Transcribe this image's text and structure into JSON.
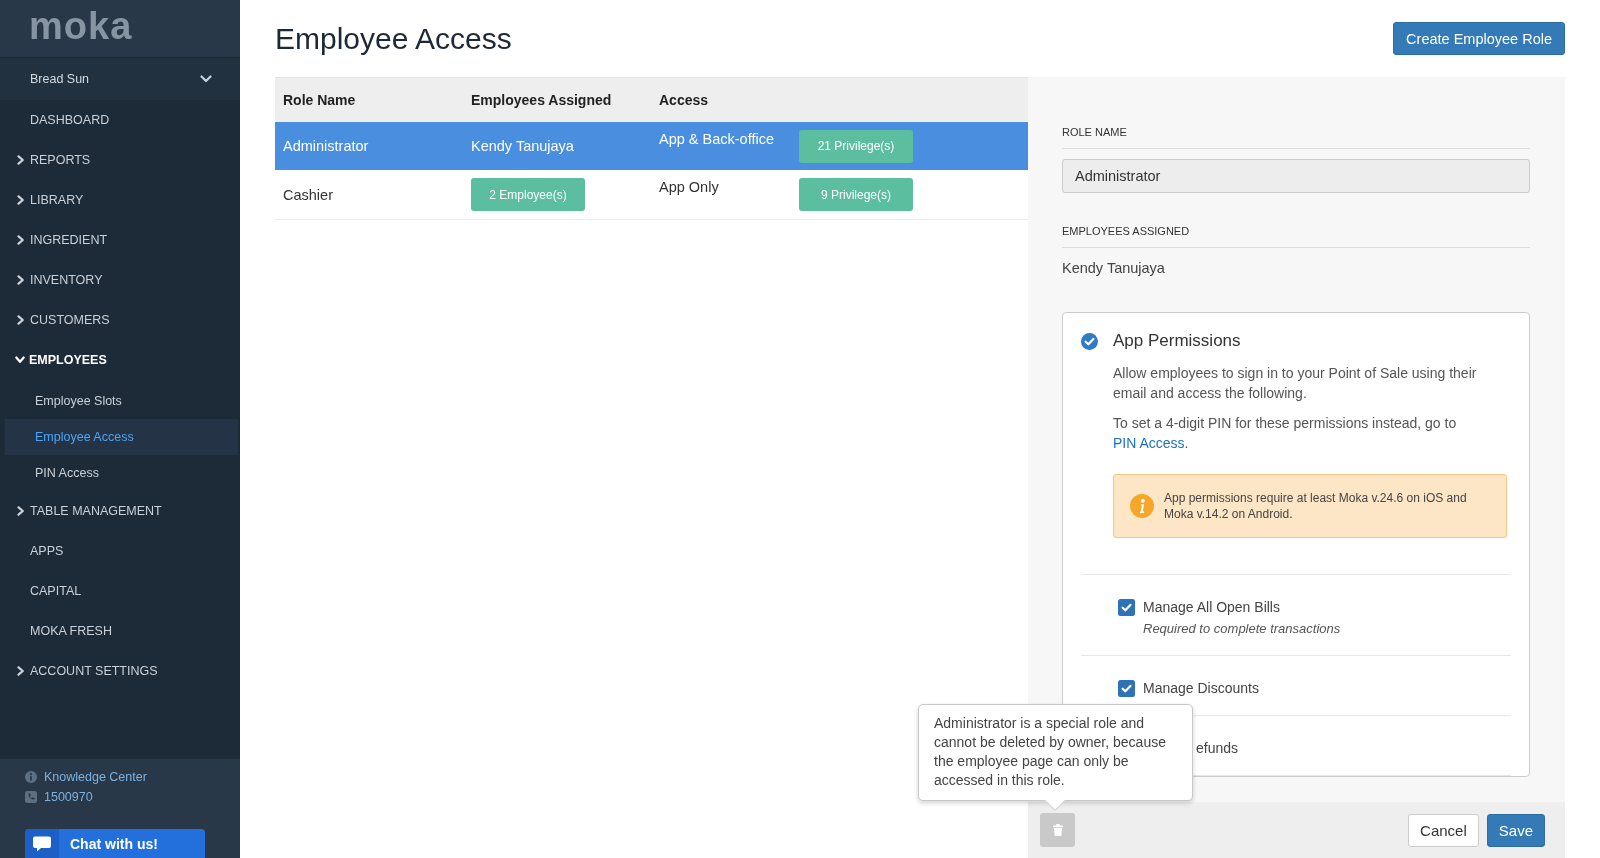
{
  "sidebar": {
    "logo": "moka",
    "store": "Bread Sun",
    "items": [
      {
        "label": "DASHBOARD",
        "kind": "link"
      },
      {
        "label": "REPORTS",
        "kind": "group",
        "expanded": false
      },
      {
        "label": "LIBRARY",
        "kind": "group",
        "expanded": false
      },
      {
        "label": "INGREDIENT",
        "kind": "group",
        "expanded": false
      },
      {
        "label": "INVENTORY",
        "kind": "group",
        "expanded": false
      },
      {
        "label": "CUSTOMERS",
        "kind": "group",
        "expanded": false
      },
      {
        "label": "EMPLOYEES",
        "kind": "group",
        "expanded": true,
        "children": [
          {
            "label": "Employee Slots",
            "selected": false
          },
          {
            "label": "Employee Access",
            "selected": true
          },
          {
            "label": "PIN Access",
            "selected": false
          }
        ]
      },
      {
        "label": "TABLE MANAGEMENT",
        "kind": "group",
        "expanded": false
      },
      {
        "label": "APPS",
        "kind": "link"
      },
      {
        "label": "CAPITAL",
        "kind": "link"
      },
      {
        "label": "MOKA FRESH",
        "kind": "link"
      },
      {
        "label": "ACCOUNT SETTINGS",
        "kind": "group",
        "expanded": false
      }
    ],
    "footer_links": [
      {
        "label": "Knowledge Center",
        "kind": "info"
      },
      {
        "label": "1500970",
        "kind": "phone"
      }
    ],
    "chat_button": "Chat with us!"
  },
  "header": {
    "title": "Employee Access",
    "create_button": "Create Employee Role"
  },
  "table": {
    "columns": [
      "Role Name",
      "Employees Assigned",
      "Access"
    ],
    "rows": [
      {
        "selected": true,
        "role": "Administrator",
        "employees": {
          "kind": "text",
          "text": "Kendy Tanujaya"
        },
        "access": "App & Back-office",
        "privileges": "21 Privilege(s)"
      },
      {
        "selected": false,
        "role": "Cashier",
        "employees": {
          "kind": "badge",
          "text": "2 Employee(s)"
        },
        "access": "App Only",
        "privileges": "9 Privilege(s)"
      }
    ]
  },
  "detail": {
    "role_name": {
      "label": "ROLE NAME",
      "value": "Administrator",
      "disabled": true
    },
    "employees_assigned": {
      "label": "EMPLOYEES ASSIGNED",
      "value": "Kendy Tanujaya"
    },
    "app_permissions": {
      "checked": true,
      "title": "App Permissions",
      "description": "Allow employees to sign in to your Point of Sale using their email and access the following.",
      "pin_note": "To set a 4-digit PIN for these permissions instead, go to ",
      "pin_link": "PIN Access",
      "pin_note_end": ".",
      "warning": "App permissions require at least Moka v.24.6 on iOS and Moka v.14.2 on Android.",
      "permissions": [
        {
          "kind": "checkbox",
          "label": "Manage All Open Bills",
          "note": "Required to complete transactions",
          "checked": true
        },
        {
          "kind": "checkbox",
          "label": "Manage Discounts",
          "checked": true
        },
        {
          "kind": "covered",
          "label": "efunds"
        }
      ]
    },
    "footer": {
      "delete_disabled": true,
      "cancel": "Cancel",
      "save": "Save"
    }
  },
  "tooltip": {
    "text": "Administrator is a special role and cannot be deleted by owner, because the employee page can only be accessed in this role."
  }
}
